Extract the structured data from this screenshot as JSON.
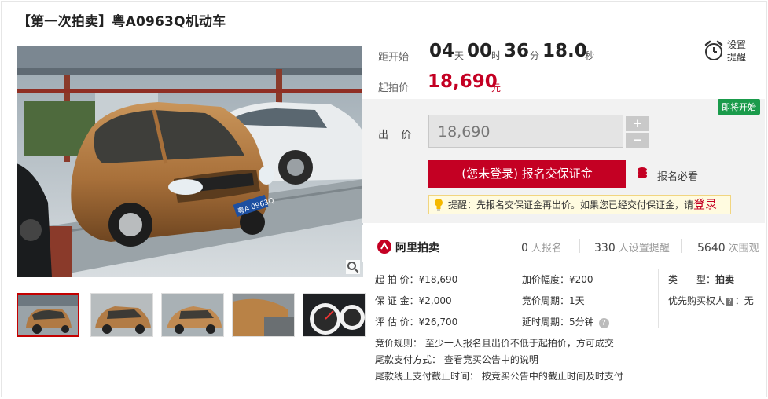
{
  "title": "【第一次拍卖】粤A0963Q机动车",
  "countdown": {
    "label": "距开始",
    "days": "04",
    "days_unit": "天",
    "hours": "00",
    "hours_unit": "时",
    "minutes": "36",
    "minutes_unit": "分",
    "seconds": "18.0",
    "seconds_unit": "秒"
  },
  "start_price": {
    "label": "起拍价",
    "value": "18,690",
    "unit": "元"
  },
  "reminder": {
    "label": "设置提醒",
    "icon": "alarm-clock-icon"
  },
  "status_badge": "即将开始",
  "bid": {
    "label": "出 价",
    "value": "18,690",
    "plus": "+",
    "minus": "−",
    "deposit_button": "(您未登录) 报名交保证金",
    "must_see": "报名必看",
    "tip_text": "提醒：先报名交保证金再出价。如果您已经交付保证金，请",
    "tip_login": "登录"
  },
  "stats": {
    "brand": "阿里拍卖",
    "signups": "0",
    "signups_unit": "人报名",
    "reminders": "330",
    "reminders_unit": "人设置提醒",
    "views": "5640",
    "views_unit": "次围观"
  },
  "info": {
    "start_price": "起 拍 价：¥18,690",
    "deposit": "保 证 金：¥2,000",
    "appraisal": "评 估 价：¥26,700",
    "increment": "加价幅度：¥200",
    "cycle": "竞价周期：1天",
    "delay": "延时周期：5分钟",
    "type_label": "类　　型：",
    "type_value": "拍卖",
    "priority": "优先购买权人",
    "priority_badge": "?",
    "priority_value": "：无"
  },
  "rules": {
    "rule1": "竞价规则：  至少一人报名且出价不低于起拍价，方可成交",
    "rule2": "尾款支付方式：  查看竞买公告中的说明",
    "rule3": "尾款线上支付截止时间：  按竞买公告中的截止时间及时支付"
  },
  "plate_text": "粤A 0963Q",
  "colors": {
    "accent": "#c40023",
    "green": "#1a9b4b"
  }
}
